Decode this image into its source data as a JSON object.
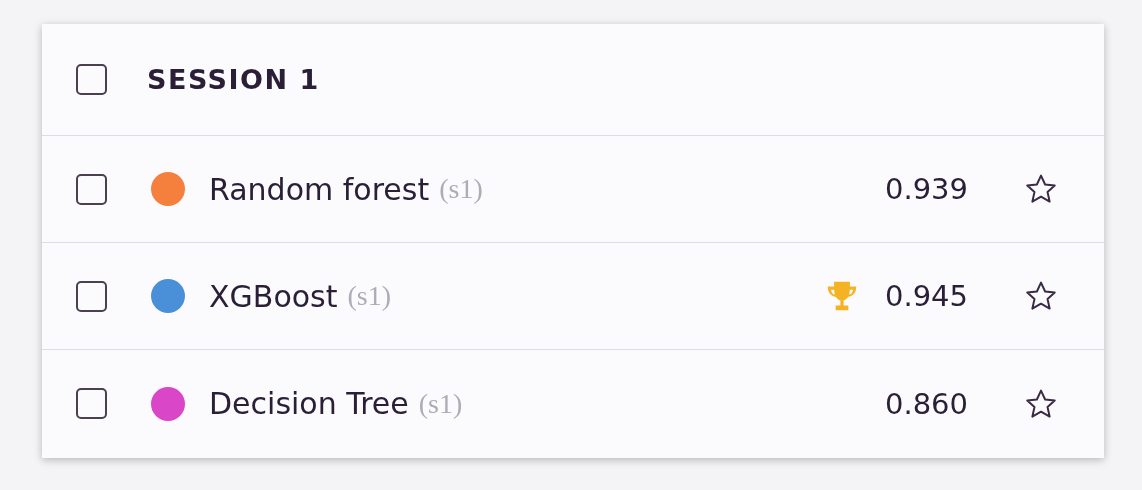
{
  "session": {
    "title": "SESSION 1",
    "checked": false
  },
  "models": [
    {
      "name": "Random forest",
      "tag": "(s1)",
      "color": "#f5803e",
      "checked": false,
      "best": false,
      "score": "0.939",
      "starred": false
    },
    {
      "name": "XGBoost",
      "tag": "(s1)",
      "color": "#4a90d9",
      "checked": false,
      "best": true,
      "score": "0.945",
      "starred": false
    },
    {
      "name": "Decision Tree",
      "tag": "(s1)",
      "color": "#d946c8",
      "checked": false,
      "best": false,
      "score": "0.860",
      "starred": false
    }
  ]
}
